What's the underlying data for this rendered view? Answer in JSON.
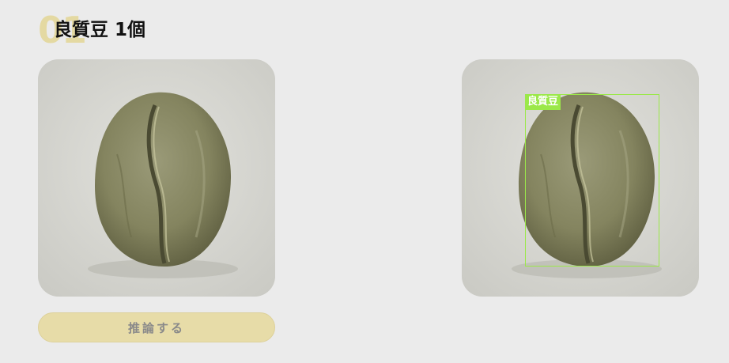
{
  "header": {
    "number": "01",
    "title": "良質豆 1個"
  },
  "input_image": {
    "alt": "コーヒー生豆"
  },
  "output_image": {
    "detection_label": "良質豆"
  },
  "actions": {
    "infer_label": "推論する"
  },
  "colors": {
    "accent": "#e7dca8",
    "number_color": "#e4d9a2",
    "detection_box": "#9be84a",
    "background": "#ebebeb"
  }
}
